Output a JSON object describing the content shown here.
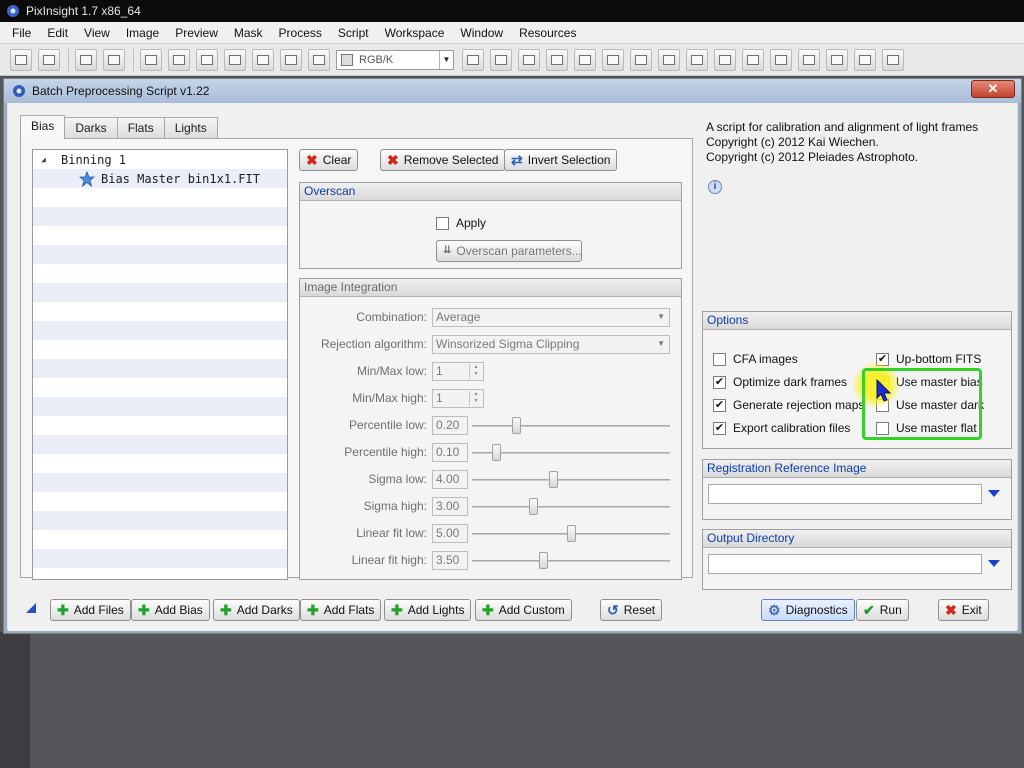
{
  "app": {
    "title": "PixInsight 1.7 x86_64",
    "menu": [
      "File",
      "Edit",
      "View",
      "Image",
      "Preview",
      "Mask",
      "Process",
      "Script",
      "Workspace",
      "Window",
      "Resources"
    ],
    "toolbar_color_space": "RGB/K"
  },
  "dialog": {
    "title": "Batch Preprocessing Script v1.22",
    "close_label": "✕",
    "tabs": [
      "Bias",
      "Darks",
      "Flats",
      "Lights"
    ],
    "active_tab": "Bias",
    "tree": {
      "group": "Binning 1",
      "item": "Bias Master bin1x1.FIT"
    },
    "actions": {
      "clear": "Clear",
      "remove_selected": "Remove Selected",
      "invert_selection": "Invert Selection"
    },
    "overscan": {
      "title": "Overscan",
      "apply_label": "Apply",
      "apply_checked": false,
      "params_label": "Overscan parameters..."
    },
    "integration": {
      "title": "Image Integration",
      "combination_label": "Combination:",
      "combination_value": "Average",
      "rejection_label": "Rejection algorithm:",
      "rejection_value": "Winsorized Sigma Clipping",
      "minmax_low_label": "Min/Max low:",
      "minmax_low_value": "1",
      "minmax_high_label": "Min/Max high:",
      "minmax_high_value": "1",
      "percentile_low_label": "Percentile low:",
      "percentile_low_value": "0.20",
      "percentile_high_label": "Percentile high:",
      "percentile_high_value": "0.10",
      "sigma_low_label": "Sigma low:",
      "sigma_low_value": "4.00",
      "sigma_high_label": "Sigma high:",
      "sigma_high_value": "3.00",
      "linear_low_label": "Linear fit low:",
      "linear_low_value": "5.00",
      "linear_high_label": "Linear fit high:",
      "linear_high_value": "3.50"
    },
    "sliders": {
      "percentile_low": 0.22,
      "percentile_high": 0.12,
      "sigma_low": 0.41,
      "sigma_high": 0.31,
      "linear_low": 0.5,
      "linear_high": 0.36
    },
    "description": {
      "line1": "A script for calibration and alignment of light frames",
      "line2": "Copyright (c) 2012 Kai Wiechen.",
      "line3": "Copyright (c) 2012 Pleiades Astrophoto."
    },
    "options": {
      "title": "Options",
      "cfa": {
        "label": "CFA images",
        "checked": false
      },
      "optimize_dark": {
        "label": "Optimize dark frames",
        "checked": true
      },
      "rejection_maps": {
        "label": "Generate rejection maps",
        "checked": true
      },
      "export_calibration": {
        "label": "Export calibration files",
        "checked": true
      },
      "up_bottom": {
        "label": "Up-bottom FITS",
        "checked": true
      },
      "master_bias": {
        "label": "Use master bias",
        "checked": true
      },
      "master_dark": {
        "label": "Use master dark",
        "checked": false
      },
      "master_flat": {
        "label": "Use master flat",
        "checked": false
      }
    },
    "registration": {
      "title": "Registration Reference Image",
      "value": ""
    },
    "output": {
      "title": "Output Directory",
      "value": ""
    },
    "bottom": {
      "add_files": "Add Files",
      "add_bias": "Add Bias",
      "add_darks": "Add Darks",
      "add_flats": "Add Flats",
      "add_lights": "Add Lights",
      "add_custom": "Add Custom",
      "reset": "Reset",
      "diagnostics": "Diagnostics",
      "run": "Run",
      "exit": "Exit"
    }
  }
}
